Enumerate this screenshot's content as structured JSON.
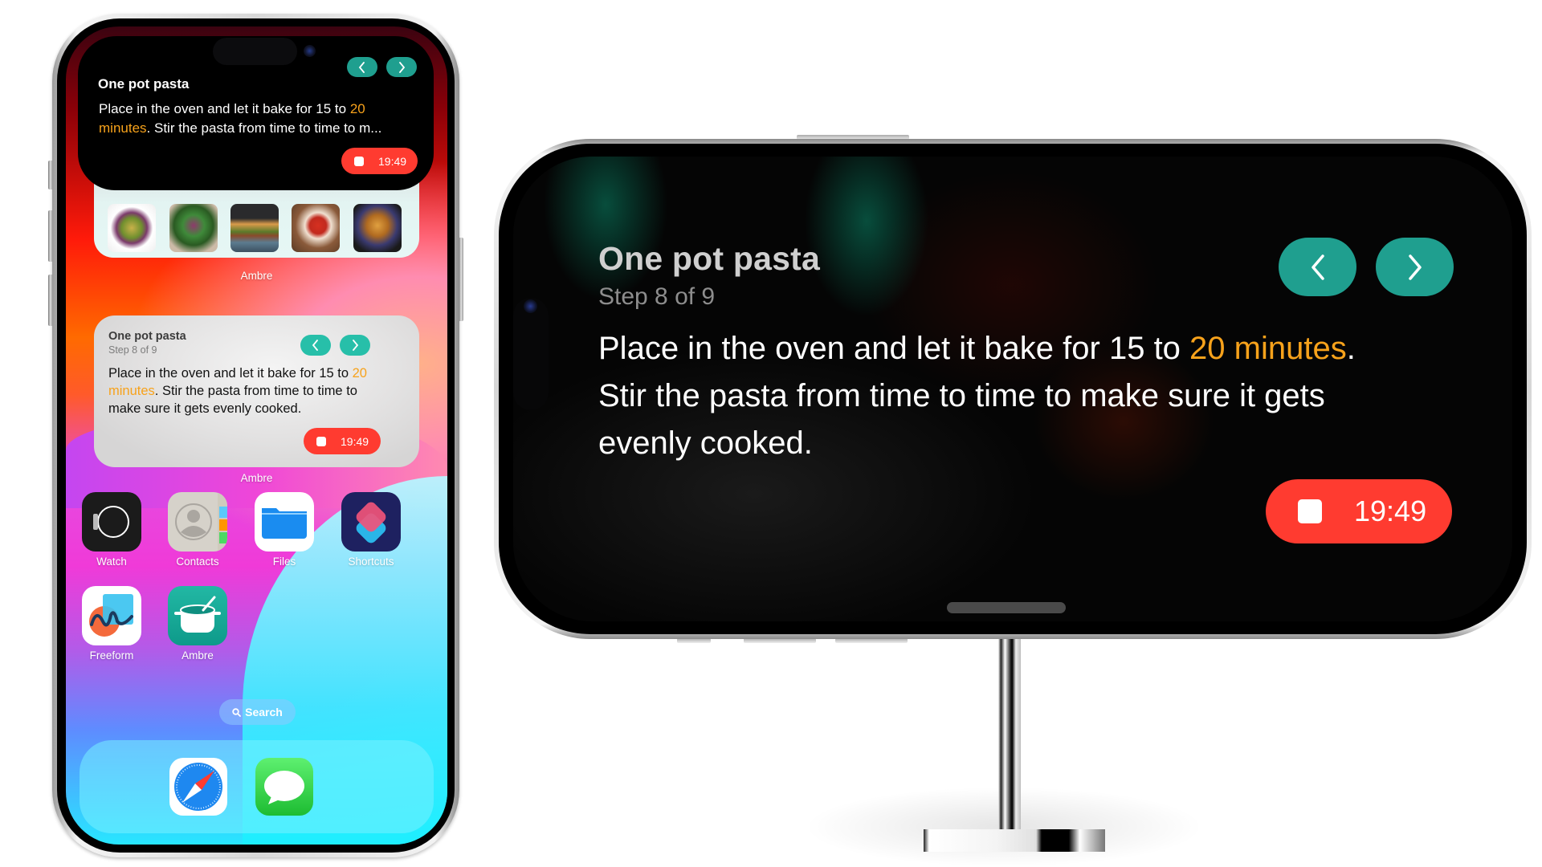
{
  "colors": {
    "accent_teal": "#1f9f8f",
    "timer_red": "#ff3b30",
    "highlight_orange": "#f7a21b"
  },
  "live_activity": {
    "title": "One pot pasta",
    "body_before": "Place in the oven and let it bake for 15 to ",
    "body_highlight": "20 minutes",
    "body_after": ". Stir the pasta from time to time to m...",
    "body_line1_end_highlight": "20",
    "body_line2_start_highlight": "minutes",
    "body_line1": "Place in the oven and let it bake for 15 to ",
    "body_line2_rest": ". Stir the pasta from time to time to m...",
    "prev_icon": "chevron-left-icon",
    "next_icon": "chevron-right-icon",
    "timer": "19:49",
    "timer_icon": "stop-icon"
  },
  "photos_widget": {
    "app_name": "Ambre",
    "photos": [
      "salad-bowl",
      "spring-rolls",
      "veggie-burger",
      "strawberry-cheesecake",
      "french-toast"
    ]
  },
  "step_widget": {
    "title": "One pot pasta",
    "step": "Step 8 of 9",
    "line1": "Place in the oven and let it bake for 15 to ",
    "line1_highlight": "20",
    "line2_highlight": "minutes",
    "line2_rest": ". Stir the pasta from time to time to",
    "line3": "make sure it gets evenly cooked.",
    "timer": "19:49",
    "app_name": "Ambre"
  },
  "apps": [
    {
      "name": "Watch",
      "icon": "watch-icon"
    },
    {
      "name": "Contacts",
      "icon": "contacts-icon"
    },
    {
      "name": "Files",
      "icon": "files-icon"
    },
    {
      "name": "Shortcuts",
      "icon": "shortcuts-icon"
    },
    {
      "name": "Freeform",
      "icon": "freeform-icon"
    },
    {
      "name": "Ambre",
      "icon": "cooking-pot-icon"
    }
  ],
  "search": {
    "label": "Search",
    "icon": "search-icon"
  },
  "dock": [
    {
      "name": "Safari",
      "icon": "safari-compass-icon"
    },
    {
      "name": "Messages",
      "icon": "messages-bubble-icon"
    }
  ],
  "standby": {
    "title": "One pot pasta",
    "step": "Step 8 of 9",
    "line1": "Place in the oven and let it bake for 15 to ",
    "line1_highlight": "20 minutes",
    "line1_end": ".",
    "line2": "Stir the pasta from time to time to make sure it gets",
    "line3": "evenly cooked.",
    "timer": "19:49",
    "prev_icon": "chevron-left-icon",
    "next_icon": "chevron-right-icon"
  }
}
